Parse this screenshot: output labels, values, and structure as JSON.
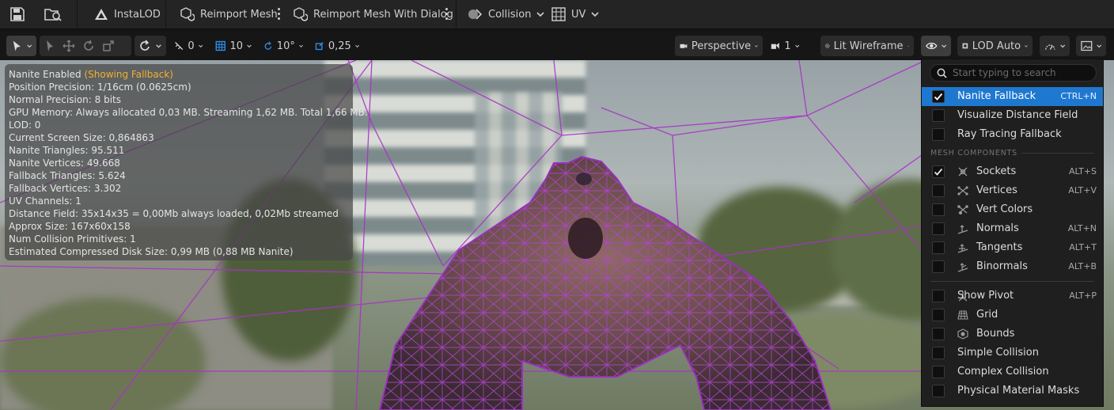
{
  "top_toolbar": {
    "instalod": "InstaLOD",
    "reimport_mesh": "Reimport Mesh",
    "reimport_with_dialog": "Reimport Mesh With Dialog",
    "collision": "Collision",
    "uv": "UV"
  },
  "viewport_toolbar": {
    "rotate_snap_value": "0",
    "grid_snap_value": "10",
    "angle_snap_value": "10°",
    "scale_snap_value": "0,25",
    "view_mode": "Perspective",
    "camera_speed": "1",
    "lit_mode": "Lit Wireframe",
    "lod": "LOD Auto"
  },
  "info_panel": {
    "nanite_enabled": "Nanite Enabled",
    "showing_fallback": "(Showing Fallback)",
    "lines": [
      "Position Precision: 1/16cm (0.0625cm)",
      "Normal Precision: 8 bits",
      "GPU Memory: Always allocated 0,03 MB. Streaming 1,62 MB. Total 1,66 MB.",
      "LOD:  0",
      "Current Screen Size:  0,864863",
      "Nanite Triangles:  95.511",
      "Nanite Vertices:  49.668",
      "Fallback Triangles:  5.624",
      "Fallback Vertices:  3.302",
      "UV Channels:  1",
      "Distance Field:  35x14x35 = 0,00Mb always loaded, 0,02Mb streamed",
      "Approx Size: 167x60x158",
      "Num Collision Primitives:  1",
      "Estimated Compressed Disk Size: 0,99 MB (0,88 MB Nanite)"
    ]
  },
  "show_menu": {
    "search_placeholder": "Start typing to search",
    "section_mesh_components": "MESH COMPONENTS",
    "items": [
      {
        "label": "Nanite Fallback",
        "shortcut": "CTRL+N",
        "checked": true
      },
      {
        "label": "Visualize Distance Field",
        "shortcut": "",
        "checked": false
      },
      {
        "label": "Ray Tracing Fallback",
        "shortcut": "",
        "checked": false
      },
      {
        "label": "Sockets",
        "shortcut": "ALT+S",
        "checked": true
      },
      {
        "label": "Vertices",
        "shortcut": "ALT+V",
        "checked": false
      },
      {
        "label": "Vert Colors",
        "shortcut": "",
        "checked": false
      },
      {
        "label": "Normals",
        "shortcut": "ALT+N",
        "checked": false
      },
      {
        "label": "Tangents",
        "shortcut": "ALT+T",
        "checked": false
      },
      {
        "label": "Binormals",
        "shortcut": "ALT+B",
        "checked": false
      },
      {
        "label": "Show Pivot",
        "shortcut": "ALT+P",
        "checked": false
      },
      {
        "label": "Grid",
        "shortcut": "",
        "checked": false
      },
      {
        "label": "Bounds",
        "shortcut": "",
        "checked": false
      },
      {
        "label": "Simple Collision",
        "shortcut": "",
        "checked": false
      },
      {
        "label": "Complex Collision",
        "shortcut": "",
        "checked": false
      },
      {
        "label": "Physical Material Masks",
        "shortcut": "",
        "checked": false
      }
    ]
  },
  "colors": {
    "selection": "#1f78d0",
    "warning": "#f0b032",
    "wireframe": "#a832c8",
    "accent": "#2f8fe8"
  }
}
